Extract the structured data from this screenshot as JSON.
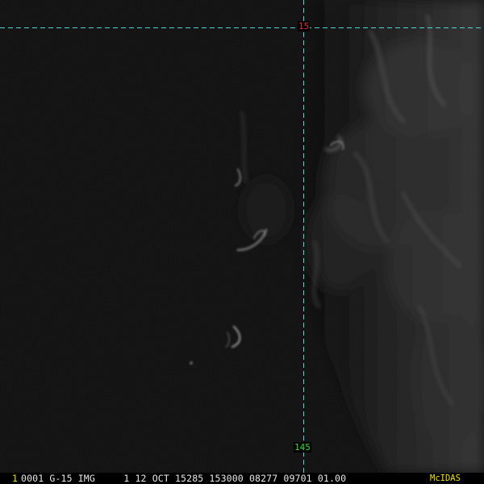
{
  "image": {
    "subject": "satellite-visible-imagery",
    "palette": {
      "background": "#000000",
      "grid_line": "#4fd6d6",
      "latitude_label": "#e03030",
      "longitude_label": "#30e030",
      "status_text": "#e6e6e6",
      "highlight_text": "#f0e000"
    }
  },
  "grid": {
    "latitude_label": "15",
    "longitude_label": "145"
  },
  "status_bar": {
    "frame_number": "1",
    "info": "0001 G-15 IMG     1 12 OCT 15285 153000 08277 09701 01.00",
    "software": "McIDAS"
  }
}
